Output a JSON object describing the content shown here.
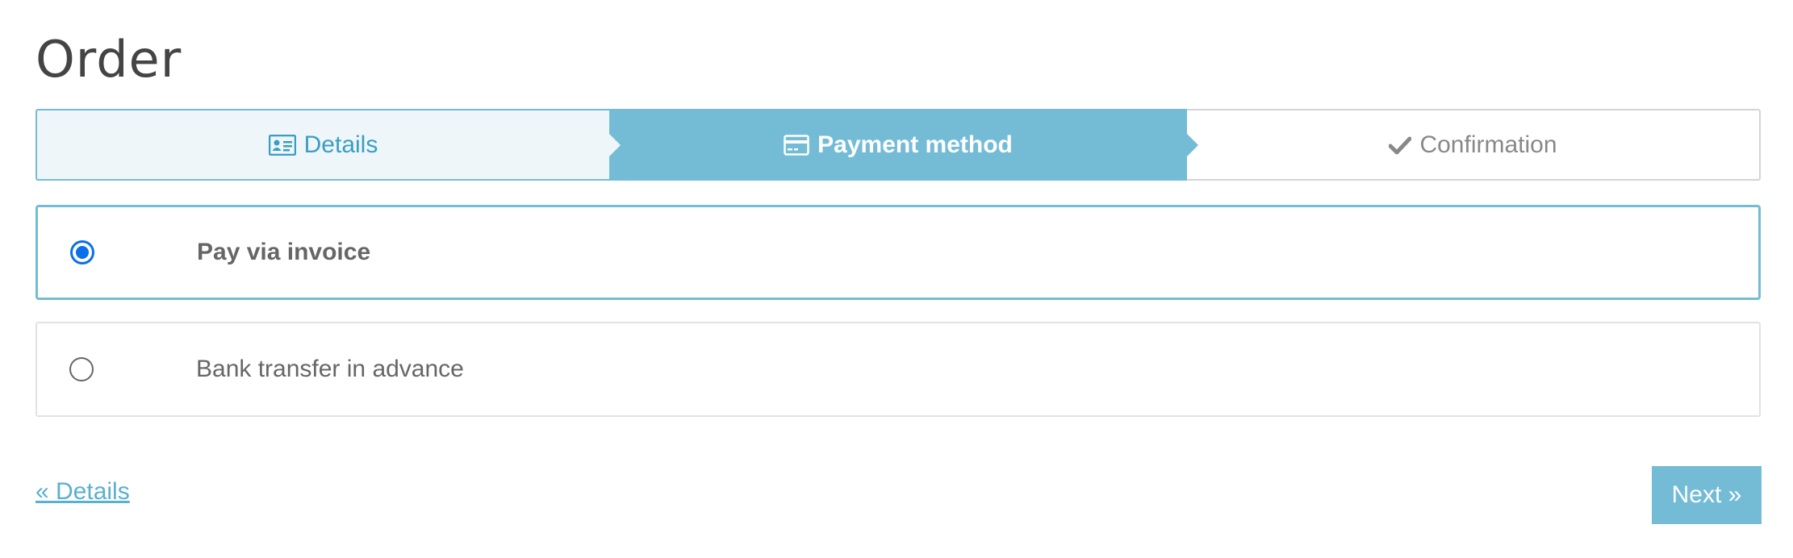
{
  "page": {
    "title": "Order"
  },
  "stepper": {
    "steps": [
      {
        "label": "Details",
        "icon": "id-card-icon",
        "state": "done"
      },
      {
        "label": "Payment method",
        "icon": "credit-card-icon",
        "state": "active"
      },
      {
        "label": "Confirmation",
        "icon": "check-icon",
        "state": "todo"
      }
    ]
  },
  "payment_options": [
    {
      "label": "Pay via invoice",
      "selected": true
    },
    {
      "label": "Bank transfer in advance",
      "selected": false
    }
  ],
  "footer": {
    "back_label": "« Details",
    "next_label": "Next »"
  },
  "colors": {
    "accent": "#74bcd6",
    "accent_text": "#3a9ec3",
    "radio_selected": "#0a6fe8"
  }
}
